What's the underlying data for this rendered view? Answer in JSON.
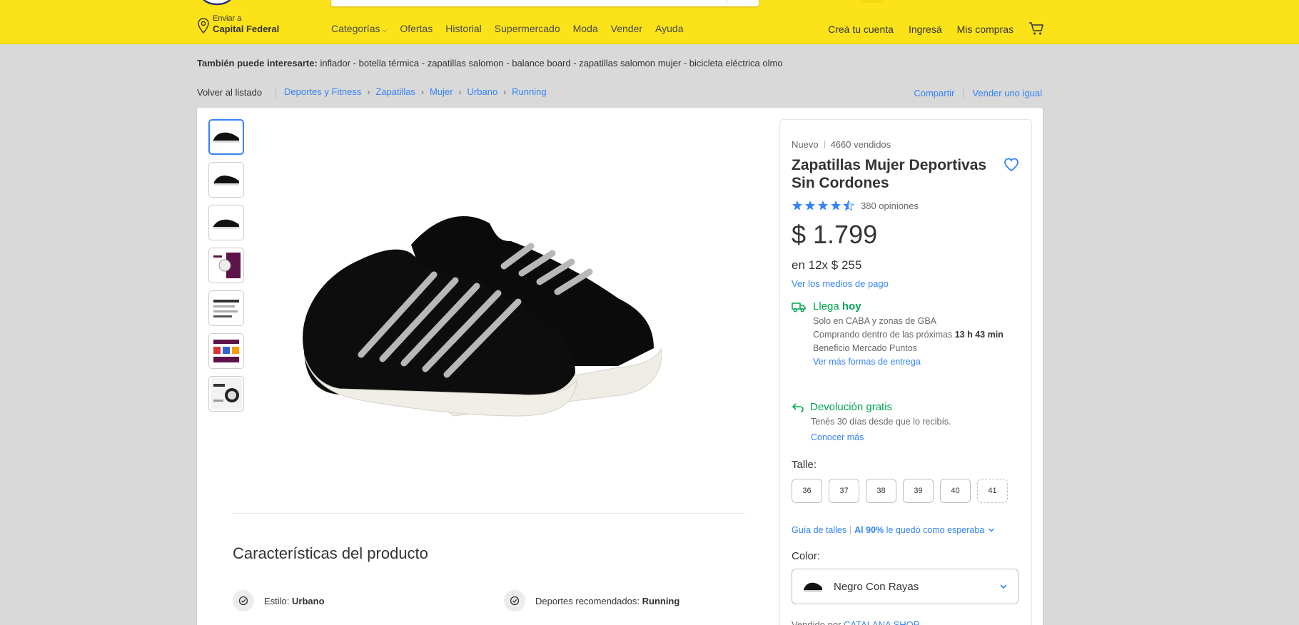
{
  "header": {
    "location": {
      "small": "Enviar a",
      "city": "Capital Federal"
    },
    "nav": [
      {
        "label": "Categorías",
        "dropdown": true
      },
      {
        "label": "Ofertas"
      },
      {
        "label": "Historial"
      },
      {
        "label": "Supermercado"
      },
      {
        "label": "Moda"
      },
      {
        "label": "Vender"
      },
      {
        "label": "Ayuda"
      }
    ],
    "user": {
      "create_account": "Creá tu cuenta",
      "login": "Ingresá",
      "purchases": "Mis compras"
    }
  },
  "suggest": {
    "label": "También puede interesarte:",
    "items": "inflador - botella térmica - zapatillas salomon - balance board - zapatillas salomon mujer - bicicleta eléctrica olmo"
  },
  "breadcrumb": {
    "back": "Volver al listado",
    "items": [
      "Deportes y Fitness",
      "Zapatillas",
      "Mujer",
      "Urbano",
      "Running"
    ],
    "share": "Compartir",
    "sell_same": "Vender uno igual"
  },
  "product": {
    "condition": "Nuevo",
    "sold": "4660 vendidos",
    "title": "Zapatillas Mujer Deportivas Sin Cordones",
    "rating": 4.5,
    "reviews": "380 opiniones",
    "price": "$ 1.799",
    "installments": "en 12x $ 255",
    "installments_cents": "",
    "payment_link": "Ver los medios de pago",
    "shipping": {
      "title_prefix": "Llega",
      "title_bold": "hoy",
      "line1": "Solo en CABA y zonas de GBA",
      "line2_prefix": "Comprando dentro de las próximas",
      "line2_bold": "13 h 43 min",
      "line3": "Beneficio Mercado Puntos",
      "link": "Ver más formas de entrega"
    },
    "returns": {
      "title": "Devolución gratis",
      "line1": "Tenés 30 días desde que lo recibís.",
      "link": "Conocer más"
    },
    "size_label": "Talle:",
    "sizes": [
      "36",
      "37",
      "38",
      "39",
      "40",
      "41"
    ],
    "size_guide": "Guía de talles",
    "fit_bold": "Al 90%",
    "fit_text": "le quedó como esperaba",
    "color_label": "Color:",
    "color_value": "Negro Con Rayas",
    "seller_prefix": "Vendido por",
    "seller_name": "CATALANA SHOP"
  },
  "features": {
    "title": "Características del producto",
    "items": [
      {
        "label": "Estilo:",
        "value": "Urbano"
      },
      {
        "label": "Deportes recomendados:",
        "value": "Running"
      }
    ]
  },
  "colors": {
    "accent": "#3483fa",
    "brand": "#fbe219",
    "green": "#00a650"
  }
}
